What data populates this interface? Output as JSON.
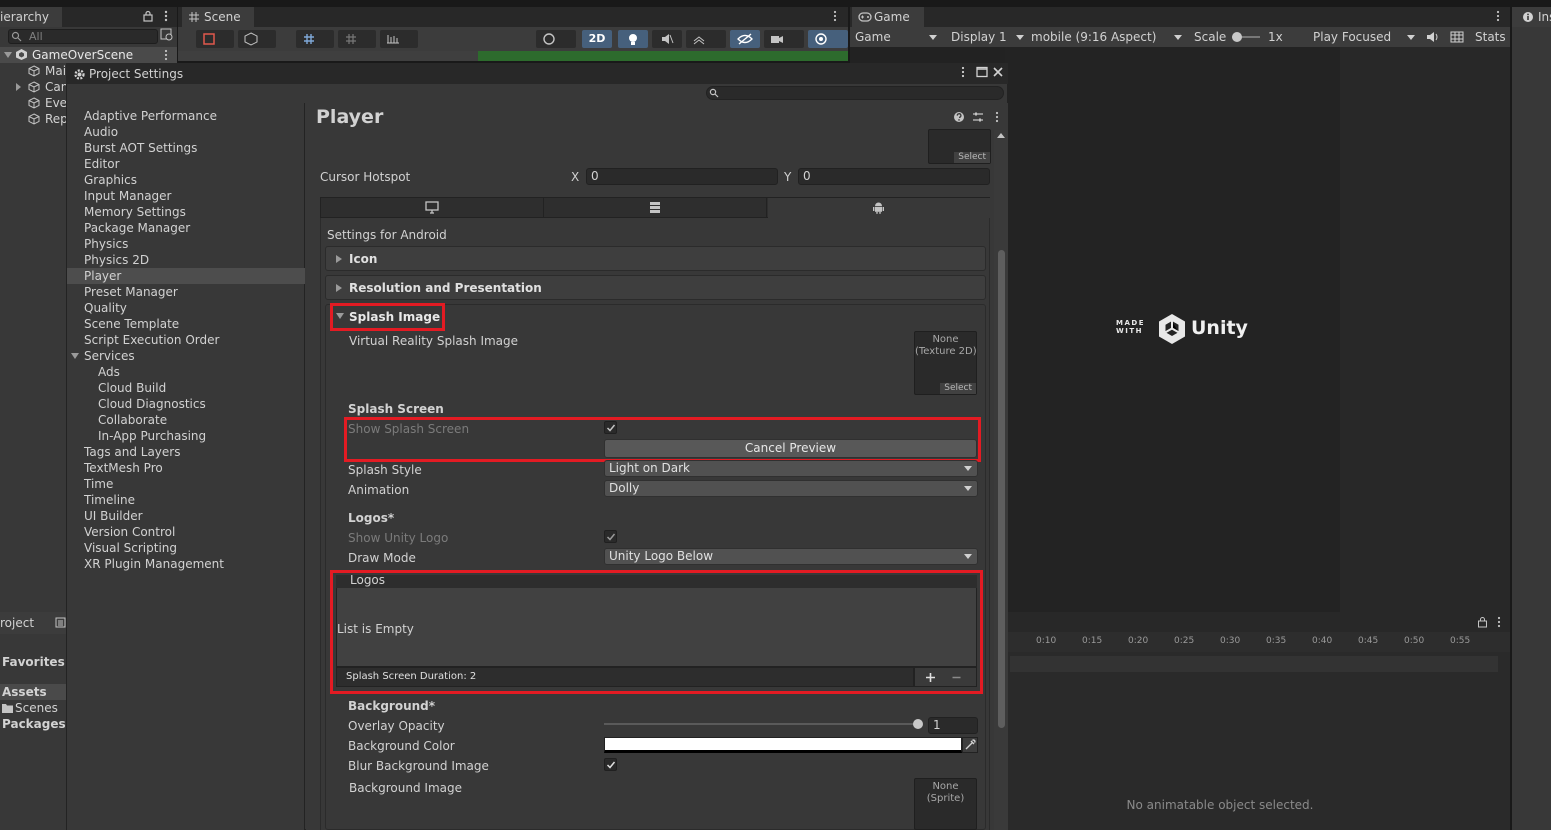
{
  "hierarchy": {
    "tab_label": "ierarchy",
    "search_placeholder": "All",
    "scene_name": "GameOverScene",
    "rows": [
      "Mai",
      "Can",
      "Eve",
      "Rep"
    ]
  },
  "scene": {
    "tab_label": "Scene",
    "toolbar_2d": "2D"
  },
  "game": {
    "tab_label": "Game",
    "view_mode": "Game",
    "display": "Display 1",
    "aspect": "mobile (9:16 Aspect)",
    "scale_label": "Scale",
    "scale_value": "1x",
    "play_mode": "Play Focused",
    "stats": "Stats",
    "splash_made": "MADE",
    "splash_with": "WITH",
    "splash_unity": "Unity"
  },
  "inspector": {
    "tab_label": "Ins"
  },
  "animation": {
    "ticks": [
      "0:10",
      "0:15",
      "0:20",
      "0:25",
      "0:30",
      "0:35",
      "0:40",
      "0:45",
      "0:50",
      "0:55"
    ],
    "empty_text": "No animatable object selected."
  },
  "project": {
    "tab_label": "roject",
    "favorites": "Favorites",
    "assets": "Assets",
    "scenes": "Scenes",
    "packages": "Packages"
  },
  "project_settings": {
    "window_title": "Project Settings",
    "nav": [
      "Adaptive Performance",
      "Audio",
      "Burst AOT Settings",
      "Editor",
      "Graphics",
      "Input Manager",
      "Memory Settings",
      "Package Manager",
      "Physics",
      "Physics 2D",
      "Player",
      "Preset Manager",
      "Quality",
      "Scene Template",
      "Script Execution Order",
      "Services"
    ],
    "nav_services": [
      "Ads",
      "Cloud Build",
      "Cloud Diagnostics",
      "Collaborate",
      "In-App Purchasing"
    ],
    "nav_after": [
      "Tags and Layers",
      "TextMesh Pro",
      "Time",
      "Timeline",
      "UI Builder",
      "Version Control",
      "Visual Scripting",
      "XR Plugin Management"
    ],
    "selected_nav": "Player"
  },
  "player": {
    "title": "Player",
    "cursor_hotspot_label": "Cursor Hotspot",
    "x_label": "X",
    "x_value": "0",
    "y_label": "Y",
    "y_value": "0",
    "select_label": "Select",
    "settings_for": "Settings for Android",
    "icon_section": "Icon",
    "resolution_section": "Resolution and Presentation",
    "splash_section": "Splash Image",
    "vr_splash_label": "Virtual Reality Splash Image",
    "vr_splash_slot": "None\n(Texture 2D)",
    "splash_screen_header": "Splash Screen",
    "show_splash_label": "Show Splash Screen",
    "cancel_preview": "Cancel Preview",
    "splash_style_label": "Splash Style",
    "splash_style_value": "Light on Dark",
    "animation_label": "Animation",
    "animation_value": "Dolly",
    "logos_header": "Logos*",
    "show_unity_logo_label": "Show Unity Logo",
    "draw_mode_label": "Draw Mode",
    "draw_mode_value": "Unity Logo Below",
    "logos_list_title": "Logos",
    "list_empty": "List is Empty",
    "splash_duration": "Splash Screen Duration: 2",
    "background_header": "Background*",
    "overlay_opacity_label": "Overlay Opacity",
    "overlay_opacity_value": "1",
    "background_color_label": "Background Color",
    "blur_bg_label": "Blur Background Image",
    "bg_image_label": "Background Image",
    "bg_image_slot": "None\n(Sprite)"
  },
  "colors": {
    "highlight_box": "#e31b23",
    "active_toggle": "#46607c"
  }
}
